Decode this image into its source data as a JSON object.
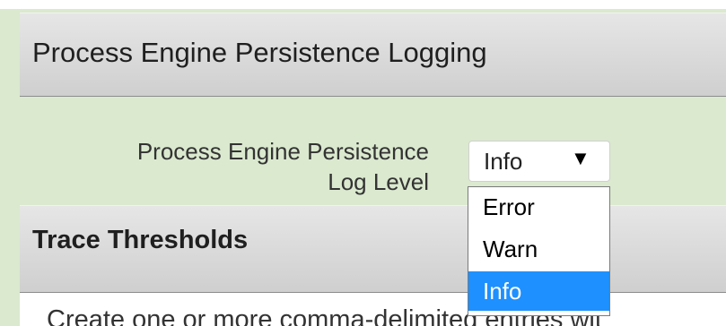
{
  "sections": {
    "persistence": {
      "title": "Process Engine Persistence Logging"
    },
    "trace": {
      "title": "Trace Thresholds",
      "description": "Create one or more comma-delimited entries wit"
    }
  },
  "log_level_field": {
    "label_line1": "Process Engine Persistence",
    "label_line2": "Log Level",
    "selected": "Info",
    "arrow": "▼",
    "options": [
      "Error",
      "Warn",
      "Info"
    ]
  },
  "colors": {
    "page_background": "#dbe9cf",
    "selected_option": "#1e90ff"
  }
}
